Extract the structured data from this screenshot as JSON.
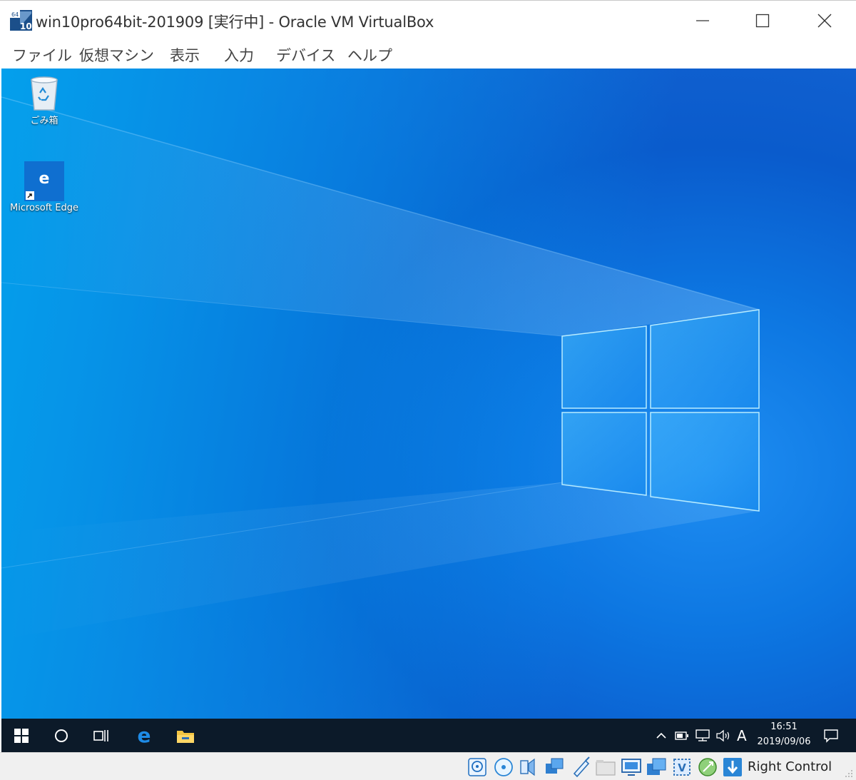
{
  "window": {
    "title": "win10pro64bit-201909 [実行中] - Oracle VM VirtualBox",
    "logo_badge": "10",
    "logo_arch": "64"
  },
  "menu": {
    "items": [
      {
        "label": "ファイル"
      },
      {
        "label": "仮想マシン"
      },
      {
        "label": "表示"
      },
      {
        "label": "入力"
      },
      {
        "label": "デバイス"
      },
      {
        "label": "ヘルプ"
      }
    ]
  },
  "desktop": {
    "icons": [
      {
        "label": "ごみ箱",
        "icon": "recycle-bin-icon"
      },
      {
        "label": "Microsoft Edge",
        "icon": "edge-icon",
        "glyph": "e"
      }
    ]
  },
  "taskbar": {
    "tray": {
      "ime_mode": "A",
      "time": "16:51",
      "date": "2019/09/06"
    }
  },
  "statusbar": {
    "host_key": "Right Control"
  },
  "colors": {
    "taskbar_bg": "#0c1a29",
    "desktop_blue": "#0a78e0",
    "statusbar_bg": "#f0f0f0"
  }
}
